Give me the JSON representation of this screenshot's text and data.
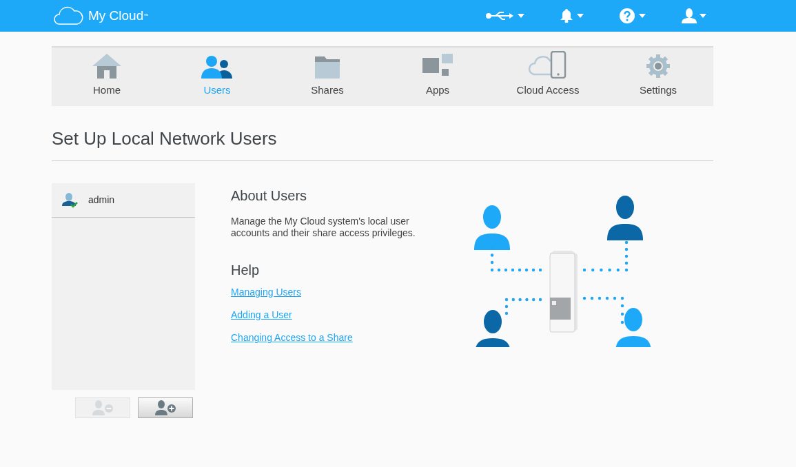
{
  "header": {
    "logo": "My Cloud",
    "trademark": "™"
  },
  "nav": [
    {
      "kind": "home",
      "label": "Home",
      "selected": false
    },
    {
      "kind": "users",
      "label": "Users",
      "selected": true
    },
    {
      "kind": "shares",
      "label": "Shares",
      "selected": false
    },
    {
      "kind": "apps",
      "label": "Apps",
      "selected": false
    },
    {
      "kind": "cloud",
      "label": "Cloud Access",
      "selected": false
    },
    {
      "kind": "settings",
      "label": "Settings",
      "selected": false
    }
  ],
  "page_title": "Set Up Local Network Users",
  "users": [
    {
      "name": "admin"
    }
  ],
  "user_buttons": [
    {
      "kind": "remove",
      "disabled": true
    },
    {
      "kind": "add",
      "disabled": false
    }
  ],
  "about": {
    "title": "About Users",
    "text": "Manage the My Cloud system's local user accounts and their share access privileges."
  },
  "help": {
    "title": "Help",
    "links": [
      "Managing Users",
      "Adding a User",
      "Changing Access to a Share"
    ]
  }
}
